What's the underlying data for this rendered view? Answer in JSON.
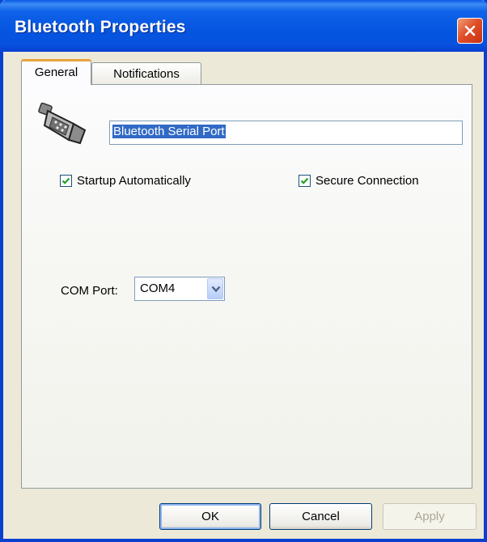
{
  "window": {
    "title": "Bluetooth Properties"
  },
  "tabs": [
    {
      "label": "General",
      "selected": true
    },
    {
      "label": "Notifications",
      "selected": false
    }
  ],
  "general": {
    "device_icon": "serial-port-icon",
    "device_name": "Bluetooth Serial Port",
    "startup_automatically": {
      "label": "Startup Automatically",
      "checked": true
    },
    "secure_connection": {
      "label": "Secure Connection",
      "checked": true
    },
    "com_port": {
      "label": "COM Port:",
      "value": "COM4"
    }
  },
  "buttons": {
    "ok": "OK",
    "cancel": "Cancel",
    "apply": "Apply"
  },
  "colors": {
    "titlebar": "#0555e0",
    "highlight": "#316ac5",
    "checkmark": "#21a121",
    "close": "#e0502a"
  }
}
